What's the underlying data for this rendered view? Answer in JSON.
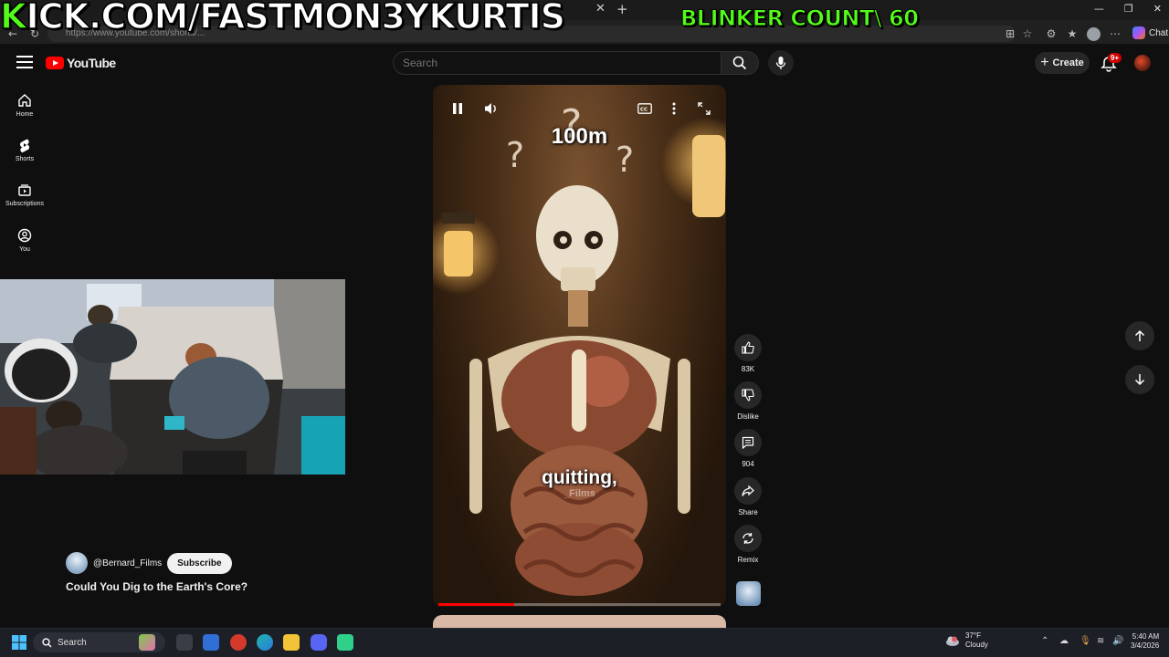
{
  "stream_overlay": {
    "kick_url_first": "K",
    "kick_url_rest": "ICK.COM/FASTMON3YKURTIS",
    "blinker_count": "BLINKER COUNT\\ 60"
  },
  "browser": {
    "url": "https://www.youtube.com/shorts/...",
    "chat_label": "Chat",
    "window_controls": [
      "—",
      "❐",
      "✕"
    ]
  },
  "youtube": {
    "logo_text": "YouTube",
    "search_placeholder": "Search",
    "create_label": "Create",
    "notification_badge": "9+",
    "nav": [
      {
        "label": "Home",
        "icon": "home-icon"
      },
      {
        "label": "Shorts",
        "icon": "shorts-icon"
      },
      {
        "label": "Subscriptions",
        "icon": "subscriptions-icon"
      },
      {
        "label": "You",
        "icon": "you-icon"
      }
    ],
    "video": {
      "overlay_text": "100m",
      "caption": "quitting,",
      "watermark": "_Films",
      "progress_fraction": 0.27,
      "channel_name": "@Bernard_Films",
      "subscribe_label": "Subscribe",
      "title": "Could You Dig to the Earth's Core?"
    },
    "actions": {
      "likes": "83K",
      "dislike_label": "Dislike",
      "comments": "904",
      "share_label": "Share",
      "remix_label": "Remix"
    }
  },
  "taskbar": {
    "search_label": "Search",
    "weather_temp": "37°F",
    "weather_cond": "Cloudy",
    "time": "5:40 AM",
    "date": "3/4/2026"
  },
  "colors": {
    "kick_green": "#53fc18",
    "yt_red": "#ff0000",
    "bg": "#0f0f0f"
  }
}
